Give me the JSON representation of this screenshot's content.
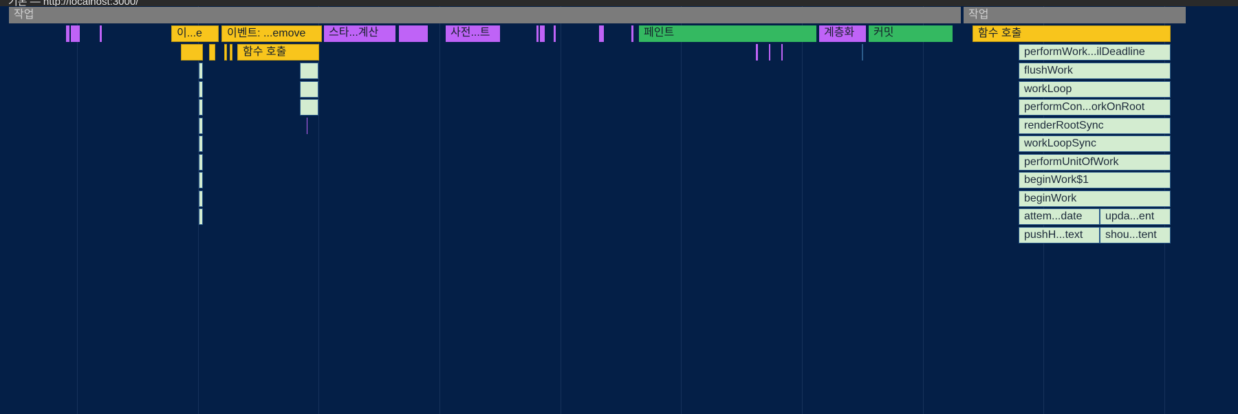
{
  "header": {
    "url_text": "기본 — http://localhost:3000/"
  },
  "colors": {
    "background": "#041f47",
    "task": "#7b7b7b",
    "scripting": "#f8c51c",
    "rendering": "#bf63f7",
    "painting": "#34b961",
    "call_stack": "#d3ecd0"
  },
  "tasks": [
    {
      "label": "작업"
    },
    {
      "label": "작업"
    }
  ],
  "events": {
    "ev_short": "이...e",
    "ev_mousemove": "이벤트: ...emove",
    "recalc_style": "스타...계산",
    "pre_paint": "사전...트",
    "paint": "페인트",
    "layerize": "계층화",
    "commit": "커밋",
    "fn_call_main": "함수 호출",
    "fn_call_nested": "함수 호출"
  },
  "call_stack": [
    "performWork...ilDeadline",
    "flushWork",
    "workLoop",
    "performCon...orkOnRoot",
    "renderRootSync",
    "workLoopSync",
    "performUnitOfWork",
    "beginWork$1",
    "beginWork"
  ],
  "call_stack_split": [
    {
      "left": "attem...date",
      "right": "upda...ent"
    },
    {
      "left": "pushH...text",
      "right": "shou...tent"
    }
  ]
}
